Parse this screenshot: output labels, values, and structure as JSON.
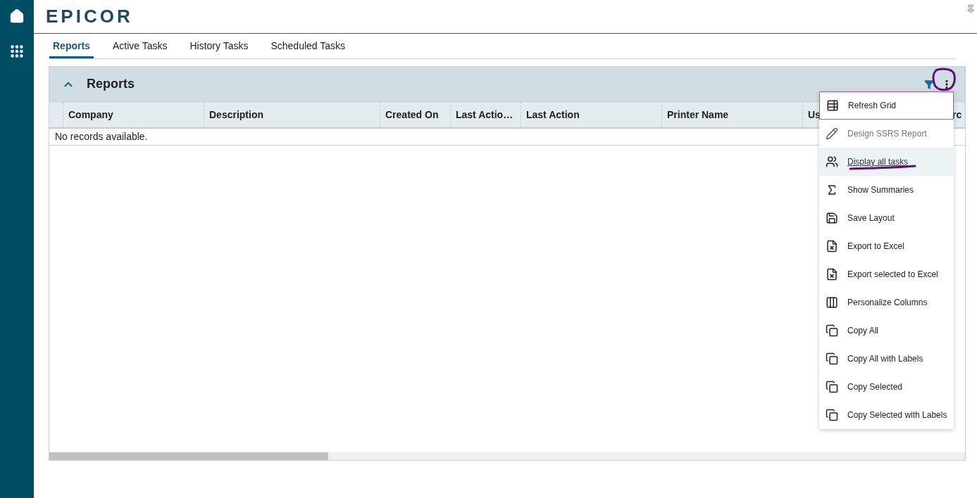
{
  "logo": "EPICOR",
  "tabs": [
    {
      "label": "Reports",
      "selected": true
    },
    {
      "label": "Active Tasks",
      "selected": false
    },
    {
      "label": "History Tasks",
      "selected": false
    },
    {
      "label": "Scheduled Tasks",
      "selected": false
    }
  ],
  "panel": {
    "title": "Reports",
    "expanded": true
  },
  "table": {
    "columns": [
      "Company",
      "Description",
      "Created On",
      "Last Actio…",
      "Last Action",
      "Printer Name",
      "Us",
      "rc"
    ],
    "empty_message": "No records available."
  },
  "menu": [
    {
      "label": "Refresh Grid",
      "focused": true,
      "highlighted": false,
      "disabled": false
    },
    {
      "label": "Design SSRS Report",
      "focused": false,
      "highlighted": false,
      "disabled": true
    },
    {
      "label": "Display all tasks",
      "focused": false,
      "highlighted": true,
      "disabled": false
    },
    {
      "label": "Show Summaries",
      "focused": false,
      "highlighted": false,
      "disabled": false
    },
    {
      "label": "Save Layout",
      "focused": false,
      "highlighted": false,
      "disabled": false
    },
    {
      "label": "Export to Excel",
      "focused": false,
      "highlighted": false,
      "disabled": false
    },
    {
      "label": "Export selected to Excel",
      "focused": false,
      "highlighted": false,
      "disabled": false
    },
    {
      "label": "Personalize Columns",
      "focused": false,
      "highlighted": false,
      "disabled": false
    },
    {
      "label": "Copy All",
      "focused": false,
      "highlighted": false,
      "disabled": false
    },
    {
      "label": "Copy All with Labels",
      "focused": false,
      "highlighted": false,
      "disabled": false
    },
    {
      "label": "Copy Selected",
      "focused": false,
      "highlighted": false,
      "disabled": false
    },
    {
      "label": "Copy Selected with Labels",
      "focused": false,
      "highlighted": false,
      "disabled": false
    }
  ]
}
